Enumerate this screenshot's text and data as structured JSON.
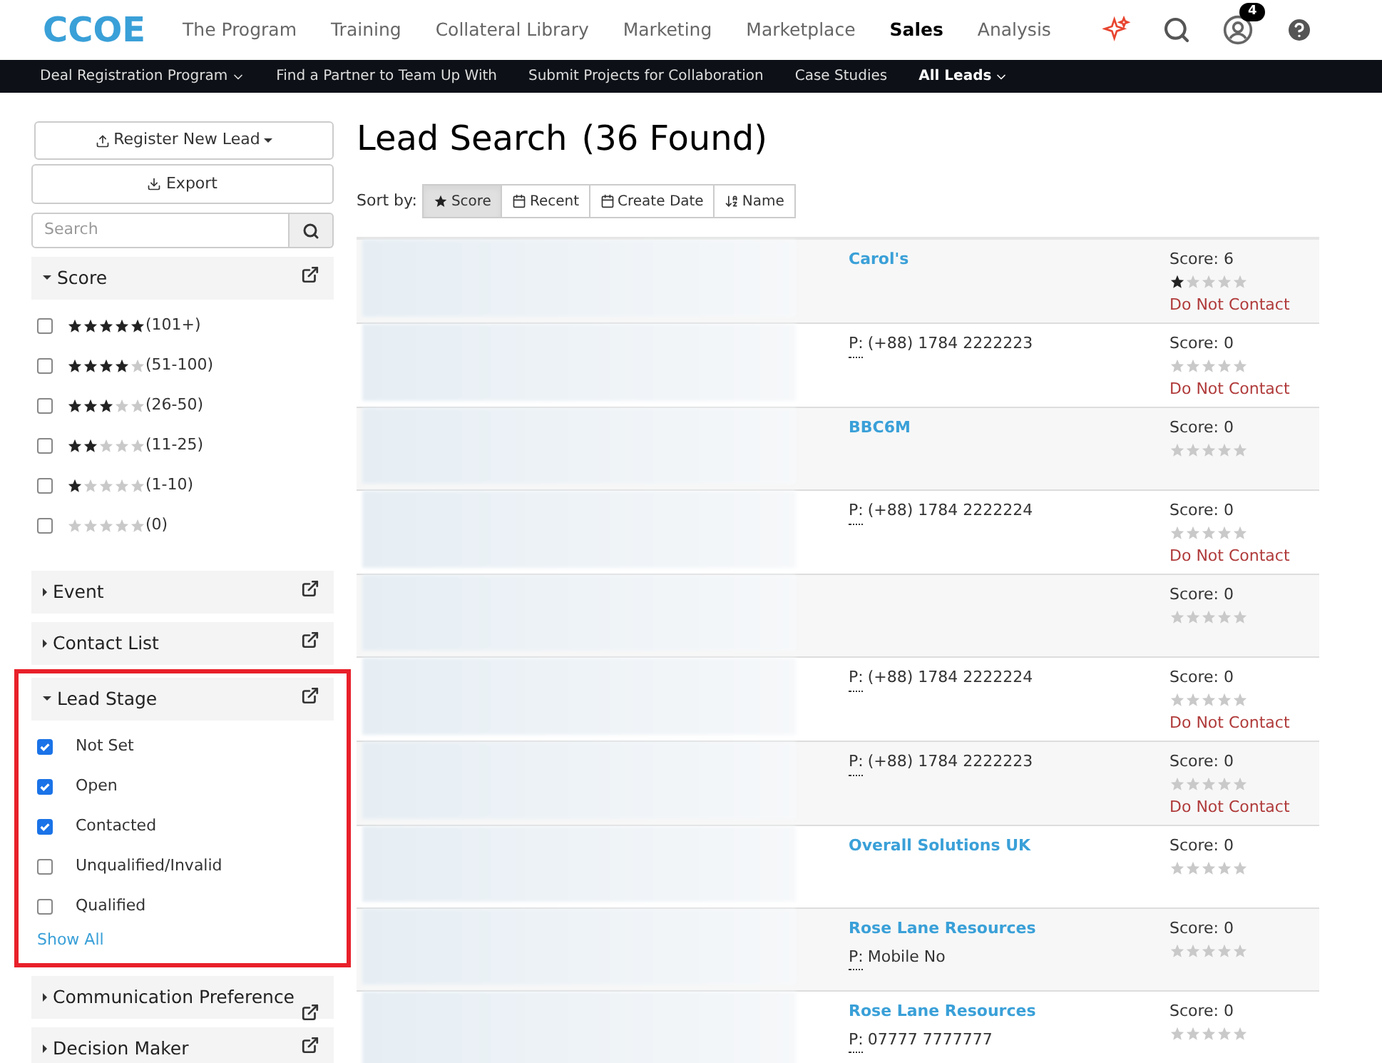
{
  "header": {
    "logo": "CCOE",
    "nav": [
      {
        "label": "The Program",
        "selected": false
      },
      {
        "label": "Training",
        "selected": false
      },
      {
        "label": "Collateral Library",
        "selected": false
      },
      {
        "label": "Marketing",
        "selected": false
      },
      {
        "label": "Marketplace",
        "selected": false
      },
      {
        "label": "Sales",
        "selected": true
      },
      {
        "label": "Analysis",
        "selected": false
      }
    ],
    "notification_count": "4"
  },
  "subnav": [
    {
      "label": "Deal Registration Program",
      "has_menu": true,
      "selected": false
    },
    {
      "label": "Find a Partner to Team Up With",
      "has_menu": false,
      "selected": false
    },
    {
      "label": "Submit Projects for Collaboration",
      "has_menu": false,
      "selected": false
    },
    {
      "label": "Case Studies",
      "has_menu": false,
      "selected": false
    },
    {
      "label": "All Leads",
      "has_menu": true,
      "selected": true
    }
  ],
  "sidebar": {
    "register_button": "Register New Lead",
    "export_button": "Export",
    "search": {
      "placeholder": "Search"
    },
    "facets": [
      {
        "title": "Score",
        "expanded": true,
        "highlighted": false,
        "items": [
          {
            "kind": "stars",
            "stars": 5,
            "label": "(101+)",
            "checked": false
          },
          {
            "kind": "stars",
            "stars": 4,
            "label": "(51-100)",
            "checked": false
          },
          {
            "kind": "stars",
            "stars": 3,
            "label": "(26-50)",
            "checked": false
          },
          {
            "kind": "stars",
            "stars": 2,
            "label": "(11-25)",
            "checked": false
          },
          {
            "kind": "stars",
            "stars": 1,
            "label": "(1-10)",
            "checked": false
          },
          {
            "kind": "stars",
            "stars": 0,
            "label": "(0)",
            "checked": false
          }
        ]
      },
      {
        "title": "Event",
        "expanded": false,
        "highlighted": false
      },
      {
        "title": "Contact List",
        "expanded": false,
        "highlighted": false
      },
      {
        "title": "Lead Stage",
        "expanded": true,
        "highlighted": true,
        "items": [
          {
            "kind": "text",
            "label": "Not Set",
            "checked": true
          },
          {
            "kind": "text",
            "label": "Open",
            "checked": true
          },
          {
            "kind": "text",
            "label": "Contacted",
            "checked": true
          },
          {
            "kind": "text",
            "label": "Unqualified/Invalid",
            "checked": false
          },
          {
            "kind": "text",
            "label": "Qualified",
            "checked": false
          }
        ],
        "show_all": "Show All"
      },
      {
        "title": "Communication Preference",
        "expanded": false,
        "highlighted": false
      },
      {
        "title": "Decision Maker",
        "expanded": false,
        "highlighted": false
      }
    ]
  },
  "main": {
    "title": "Lead Search",
    "count": "(36 Found)",
    "sort_label": "Sort by:",
    "sort_options": [
      {
        "label": "Score",
        "selected": true
      },
      {
        "label": "Recent",
        "selected": false
      },
      {
        "label": "Create Date",
        "selected": false
      },
      {
        "label": "Name",
        "selected": false
      }
    ],
    "rows": [
      {
        "company": "Carol's",
        "score": "Score: 6",
        "stars": 1,
        "status": "Do Not Contact"
      },
      {
        "phone_label": "P:",
        "phone": "(+88) 1784 2222223",
        "score": "Score: 0",
        "stars": 0,
        "status": "Do Not Contact"
      },
      {
        "company": "BBC6M",
        "score": "Score: 0",
        "stars": 0
      },
      {
        "phone_label": "P:",
        "phone": "(+88) 1784 2222224",
        "score": "Score: 0",
        "stars": 0,
        "status": "Do Not Contact"
      },
      {
        "score": "Score: 0",
        "stars": 0
      },
      {
        "phone_label": "P:",
        "phone": "(+88) 1784 2222224",
        "score": "Score: 0",
        "stars": 0,
        "status": "Do Not Contact"
      },
      {
        "phone_label": "P:",
        "phone": "(+88) 1784 2222223",
        "score": "Score: 0",
        "stars": 0,
        "status": "Do Not Contact"
      },
      {
        "company": "Overall Solutions UK",
        "score": "Score: 0",
        "stars": 0
      },
      {
        "company": "Rose Lane Resources",
        "phone_label": "P:",
        "phone": "Mobile No",
        "score": "Score: 0",
        "stars": 0
      },
      {
        "company": "Rose Lane Resources",
        "phone_label": "P:",
        "phone": "07777 7777777",
        "score": "Score: 0",
        "stars": 0
      }
    ]
  }
}
